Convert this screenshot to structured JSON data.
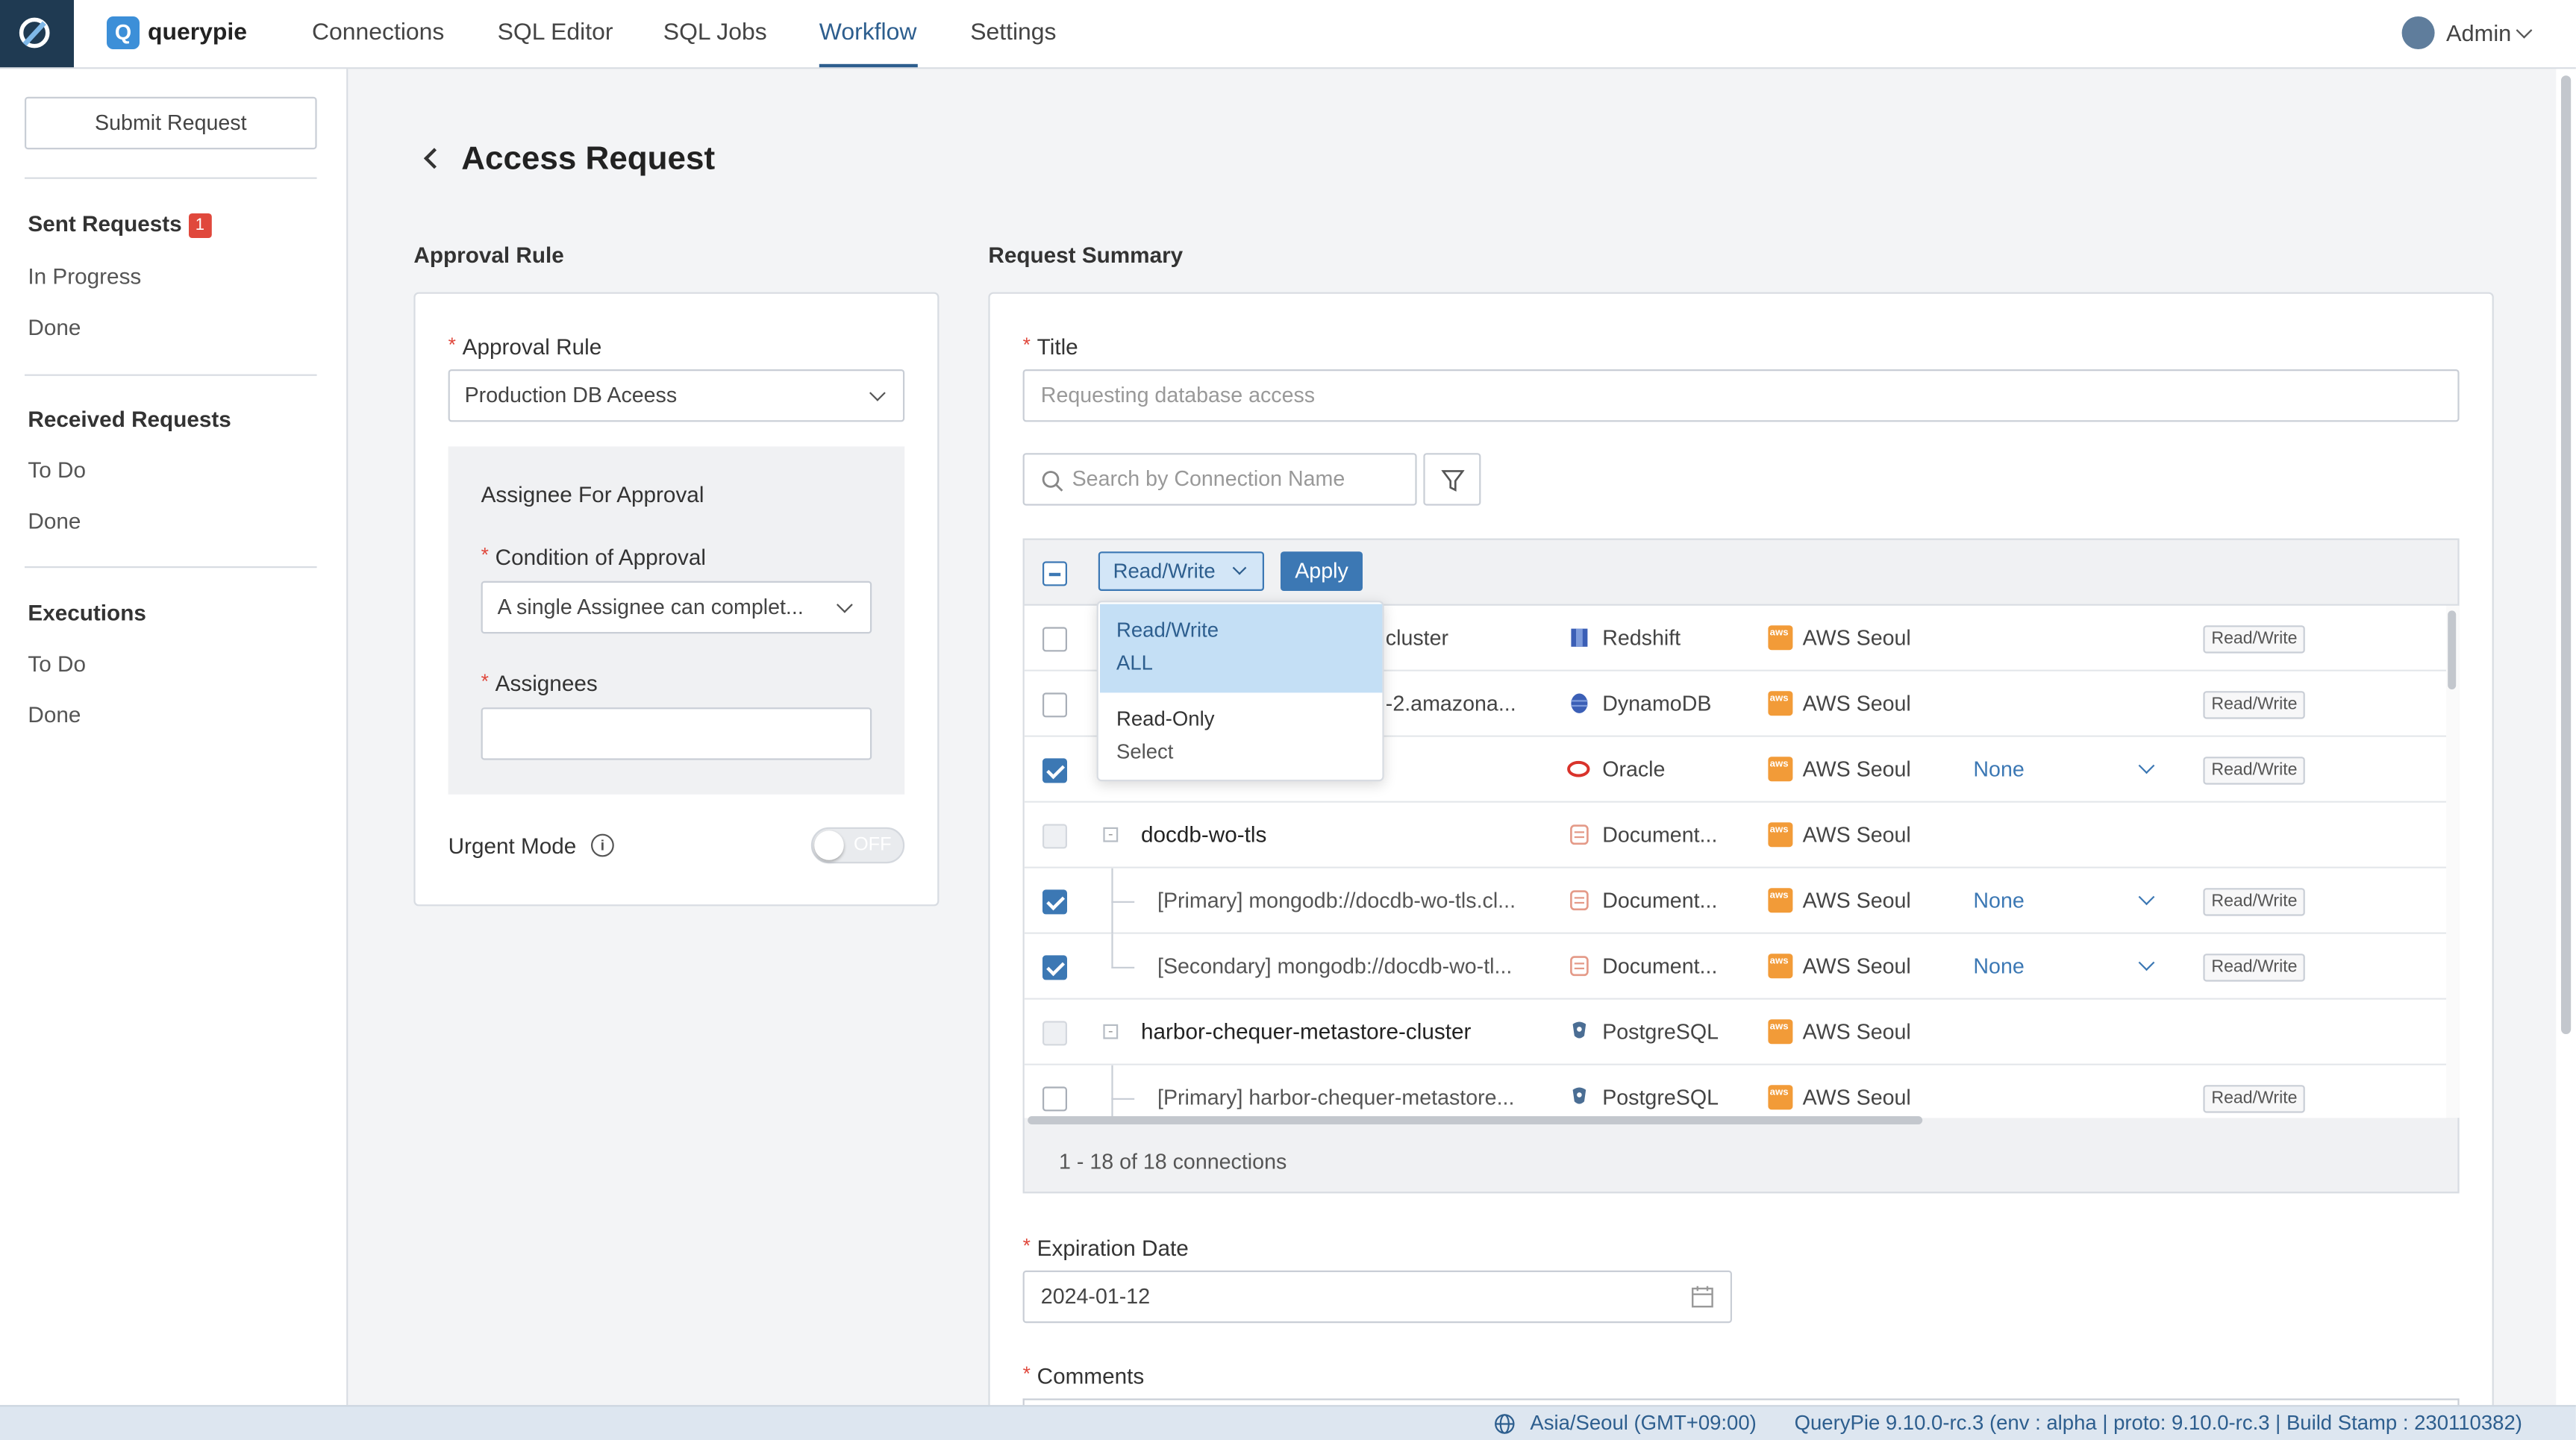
{
  "header": {
    "brand": "querypie",
    "nav": [
      "Connections",
      "SQL Editor",
      "SQL Jobs",
      "Workflow",
      "Settings"
    ],
    "active_nav": "Workflow",
    "user": "Admin"
  },
  "sidebar": {
    "submit_button": "Submit Request",
    "sent_heading": "Sent Requests",
    "sent_badge": "1",
    "sent_items": [
      "In Progress",
      "Done"
    ],
    "received_heading": "Received Requests",
    "received_items": [
      "To Do",
      "Done"
    ],
    "executions_heading": "Executions",
    "executions_items": [
      "To Do",
      "Done"
    ]
  },
  "page": {
    "title": "Access Request",
    "approval_section": "Approval Rule",
    "summary_section": "Request Summary"
  },
  "approval": {
    "rule_label": "Approval Rule",
    "rule_value": "Production DB Aceess",
    "assignee_box_title": "Assignee For Approval",
    "condition_label": "Condition of Approval",
    "condition_value": "A single Assignee can complet...",
    "assignees_label": "Assignees",
    "assignees_value": "",
    "urgent_label": "Urgent Mode",
    "urgent_state": "OFF"
  },
  "summary": {
    "title_label": "Title",
    "title_placeholder": "Requesting database access",
    "search_placeholder": "Search by Connection Name",
    "bulk_privilege": "Read/Write",
    "apply_label": "Apply",
    "dropdown_options": [
      {
        "title": "Read/Write",
        "subtitle": "ALL",
        "selected": true
      },
      {
        "title": "Read-Only",
        "subtitle": "Select",
        "selected": false
      }
    ],
    "rows": [
      {
        "name": "cluster",
        "db": "Redshift",
        "region": "AWS Seoul",
        "role": "",
        "privilege": "Read/Write",
        "checked": false
      },
      {
        "name": "-2.amazona...",
        "db": "DynamoDB",
        "region": "AWS Seoul",
        "role": "",
        "privilege": "Read/Write",
        "checked": false
      },
      {
        "name": "",
        "db": "Oracle",
        "region": "AWS Seoul",
        "role": "None",
        "privilege": "Read/Write",
        "checked": true
      },
      {
        "name": "docdb-wo-tls",
        "db": "Document...",
        "region": "AWS Seoul",
        "role": "",
        "privilege": "",
        "checked": false,
        "group": true
      },
      {
        "name": "[Primary] mongodb://docdb-wo-tls.cl...",
        "db": "Document...",
        "region": "AWS Seoul",
        "role": "None",
        "privilege": "Read/Write",
        "checked": true,
        "child": true
      },
      {
        "name": "[Secondary] mongodb://docdb-wo-tl...",
        "db": "Document...",
        "region": "AWS Seoul",
        "role": "None",
        "privilege": "Read/Write",
        "checked": true,
        "child": true,
        "last": true
      },
      {
        "name": "harbor-chequer-metastore-cluster",
        "db": "PostgreSQL",
        "region": "AWS Seoul",
        "role": "",
        "privilege": "",
        "checked": false,
        "group": true
      },
      {
        "name": "[Primary] harbor-chequer-metastore...",
        "db": "PostgreSQL",
        "region": "AWS Seoul",
        "role": "",
        "privilege": "Read/Write",
        "checked": false,
        "child": true
      }
    ],
    "pagination": "1 - 18 of 18 connections",
    "expiration_label": "Expiration Date",
    "expiration_value": "2024-01-12",
    "comments_label": "Comments"
  },
  "footer": {
    "timezone": "Asia/Seoul (GMT+09:00)",
    "build": "QueryPie 9.10.0-rc.3 (env : alpha | proto: 9.10.0-rc.3 | Build Stamp : 230110382)"
  },
  "colors": {
    "accent": "#3c78b4",
    "danger": "#e0483c",
    "aws": "#f29b38",
    "dark": "#1f3a52"
  }
}
